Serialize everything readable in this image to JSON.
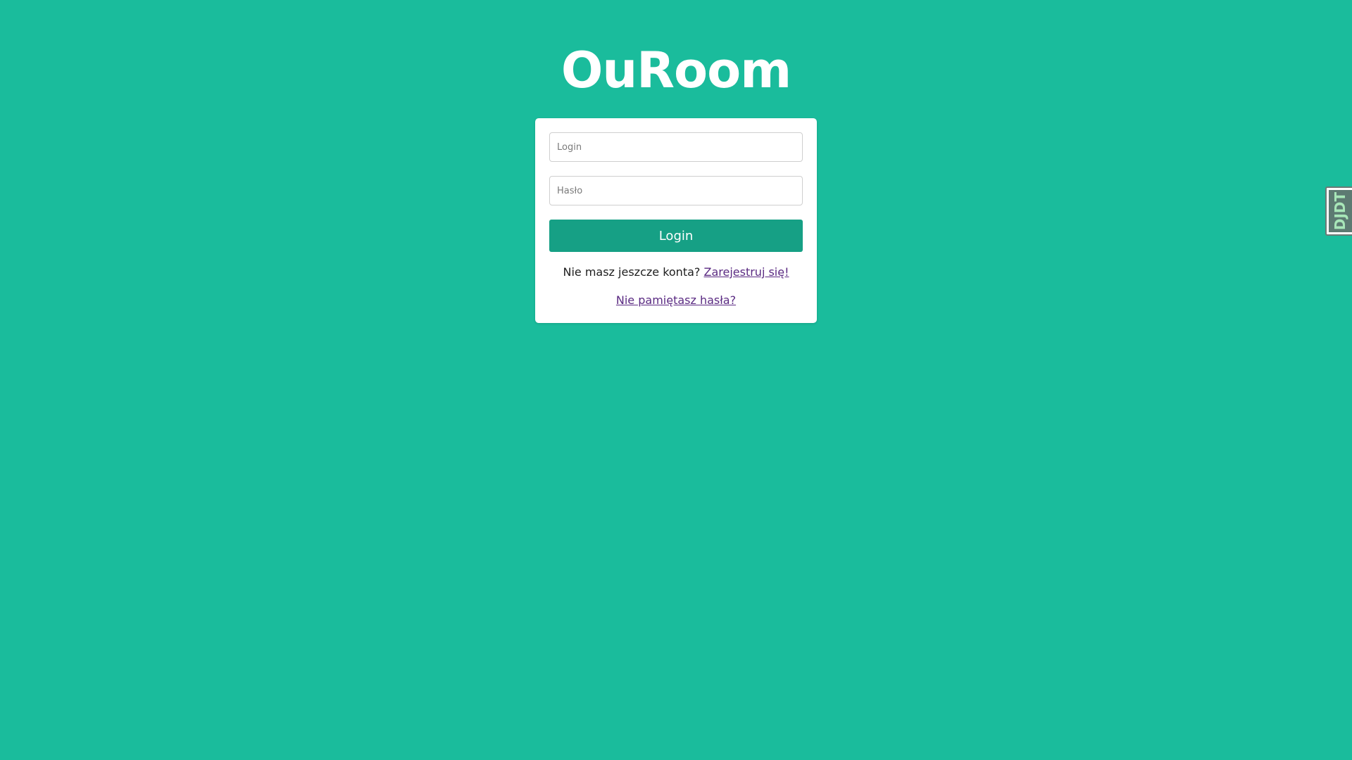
{
  "app": {
    "title": "OuRoom"
  },
  "login_form": {
    "login_placeholder": "Login",
    "password_placeholder": "Hasło",
    "submit_label": "Login",
    "signup_prompt": "Nie masz jeszcze konta?",
    "signup_link": "Zarejestruj się!",
    "forgot_link": "Nie pamiętasz hasła?"
  },
  "debug_toolbar": {
    "handle_label": "DJDT"
  },
  "colors": {
    "background": "#1abc9c",
    "button": "#16a085",
    "link": "#5a2a82",
    "card": "#ffffff"
  }
}
